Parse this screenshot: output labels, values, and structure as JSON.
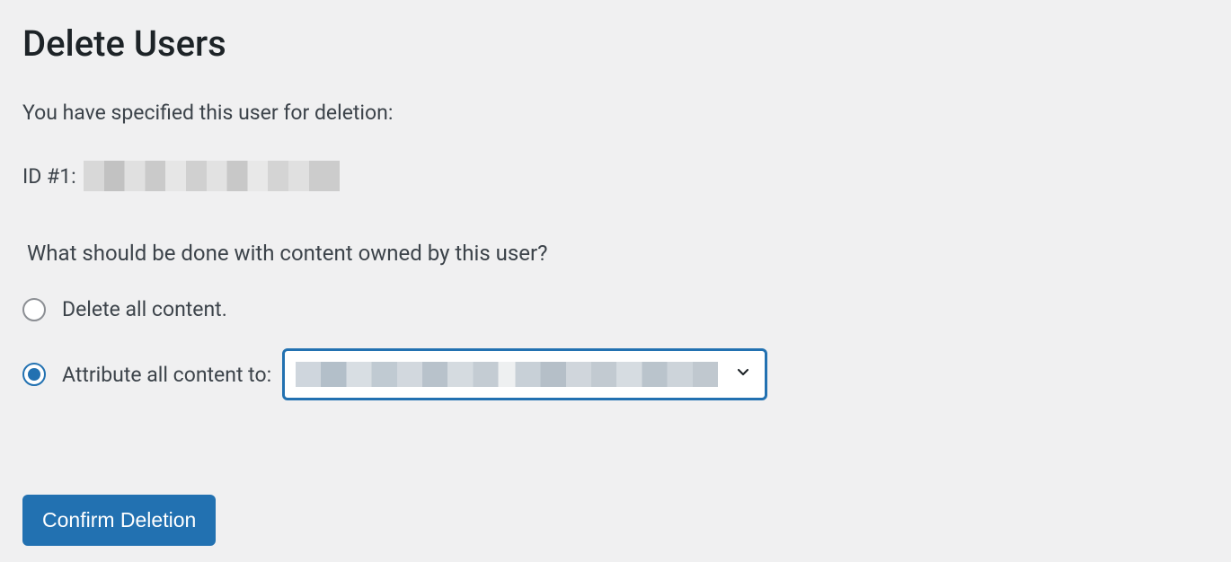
{
  "page": {
    "title": "Delete Users",
    "description": "You have specified this user for deletion:",
    "user_id_prefix": "ID #1:",
    "question": "What should be done with content owned by this user?"
  },
  "options": {
    "delete_all": {
      "label": "Delete all content.",
      "checked": false
    },
    "attribute": {
      "label": "Attribute all content to:",
      "checked": true
    }
  },
  "submit": {
    "label": "Confirm Deletion"
  }
}
